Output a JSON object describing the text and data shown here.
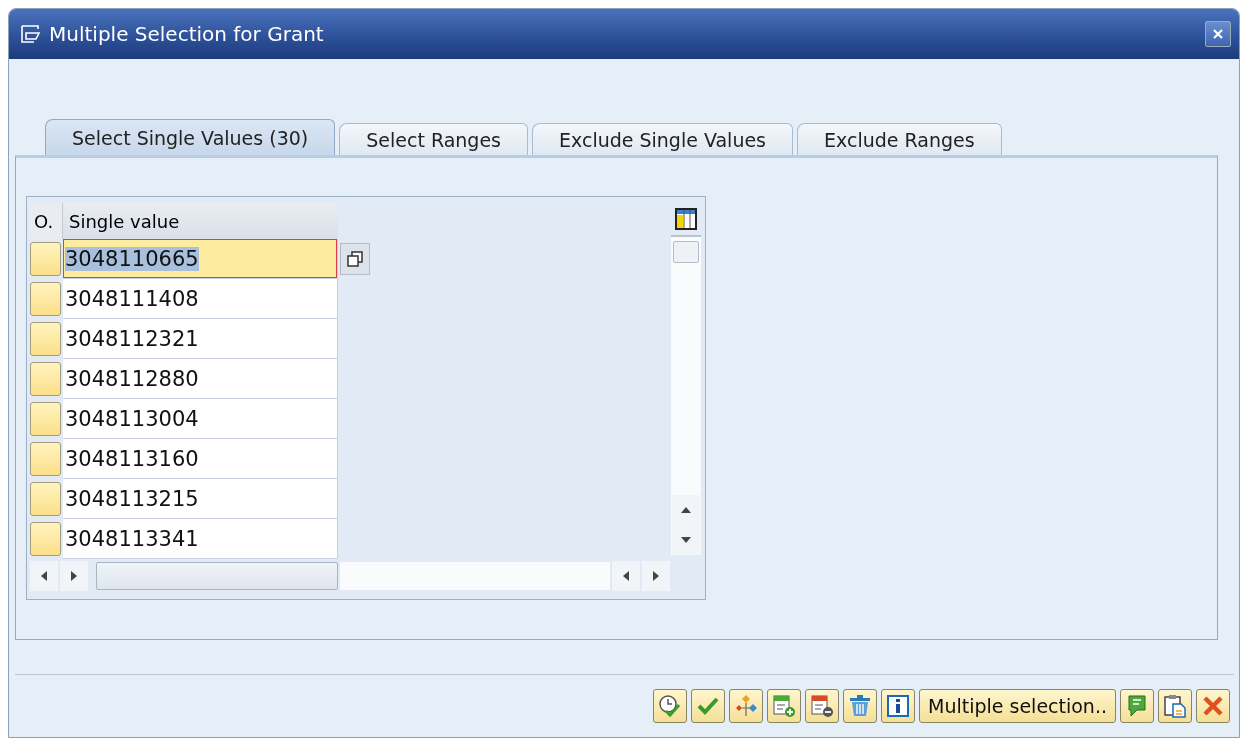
{
  "window": {
    "title": "Multiple Selection for Grant"
  },
  "tabs": [
    {
      "label": "Select Single Values (30)",
      "selected": true
    },
    {
      "label": "Select Ranges",
      "selected": false
    },
    {
      "label": "Exclude Single Values",
      "selected": false
    },
    {
      "label": "Exclude Ranges",
      "selected": false
    }
  ],
  "table": {
    "columns": [
      "O.",
      "Single value"
    ],
    "rows": [
      {
        "value": "3048110665",
        "selected": true
      },
      {
        "value": "3048111408",
        "selected": false
      },
      {
        "value": "3048112321",
        "selected": false
      },
      {
        "value": "3048112880",
        "selected": false
      },
      {
        "value": "3048113004",
        "selected": false
      },
      {
        "value": "3048113160",
        "selected": false
      },
      {
        "value": "3048113215",
        "selected": false
      },
      {
        "value": "3048113341",
        "selected": false
      }
    ]
  },
  "toolbar": [
    {
      "kind": "clock-check"
    },
    {
      "kind": "check"
    },
    {
      "kind": "diamonds"
    },
    {
      "kind": "add-row"
    },
    {
      "kind": "remove-row"
    },
    {
      "kind": "trash"
    },
    {
      "kind": "info"
    },
    {
      "kind": "text",
      "label": "Multiple selection.."
    },
    {
      "kind": "comment"
    },
    {
      "kind": "paste"
    },
    {
      "kind": "cancel"
    }
  ]
}
